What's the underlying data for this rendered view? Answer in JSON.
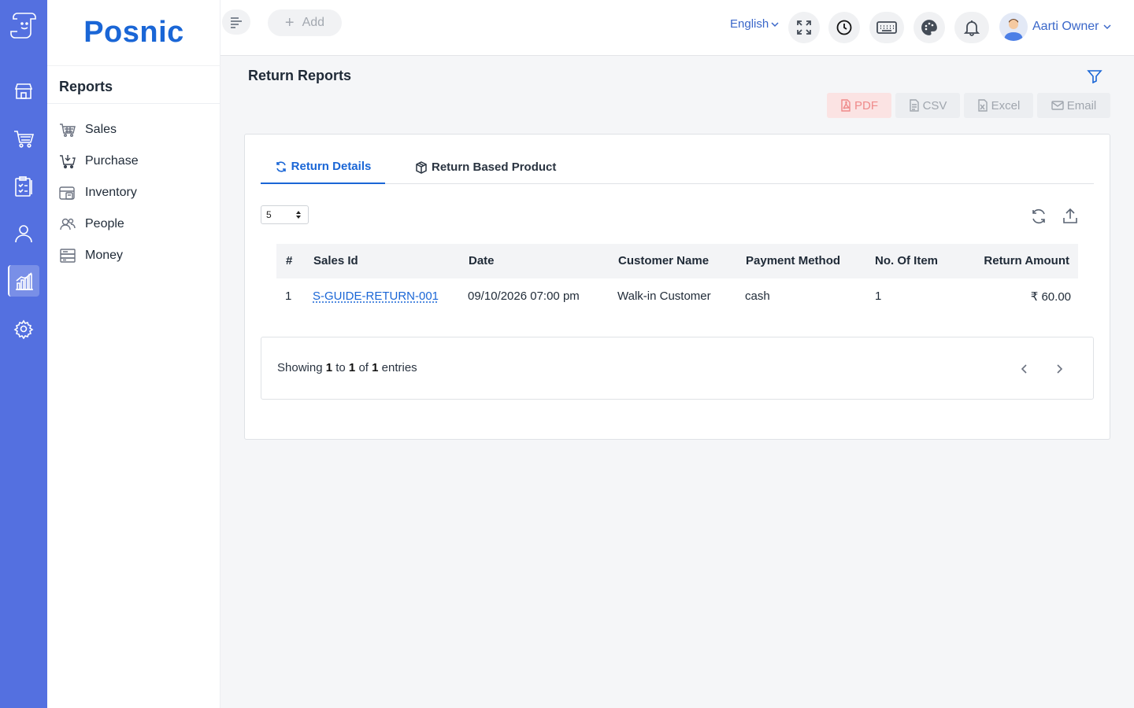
{
  "brand": {
    "name": "Posnic"
  },
  "rail": {
    "items": [
      {
        "icon": "store-icon"
      },
      {
        "icon": "cart-icon"
      },
      {
        "icon": "clipboard-icon"
      },
      {
        "icon": "user-icon"
      },
      {
        "icon": "chart-icon",
        "active": true
      },
      {
        "icon": "gear-icon"
      }
    ]
  },
  "sidebar": {
    "title": "Reports",
    "items": [
      {
        "label": "Sales",
        "icon": "basket-icon"
      },
      {
        "label": "Purchase",
        "icon": "cart-down-icon"
      },
      {
        "label": "Inventory",
        "icon": "inventory-icon"
      },
      {
        "label": "People",
        "icon": "people-icon"
      },
      {
        "label": "Money",
        "icon": "money-icon"
      }
    ]
  },
  "header": {
    "add_label": "Add",
    "language": "English",
    "user_name": "Aarti Owner"
  },
  "page": {
    "title": "Return Reports",
    "exports": {
      "pdf": "PDF",
      "csv": "CSV",
      "excel": "Excel",
      "email": "Email"
    }
  },
  "tabs": [
    {
      "label": "Return Details",
      "active": true
    },
    {
      "label": "Return Based Product",
      "active": false
    }
  ],
  "table": {
    "page_size": "5",
    "columns": [
      "#",
      "Sales Id",
      "Date",
      "Customer Name",
      "Payment Method",
      "No. Of Item",
      "Return Amount"
    ],
    "rows": [
      {
        "index": "1",
        "sales_id": "S-GUIDE-RETURN-001",
        "date": "09/10/2026 07:00 pm",
        "customer": "Walk-in Customer",
        "payment": "cash",
        "items": "1",
        "amount": "₹ 60.00"
      }
    ]
  },
  "pager": {
    "showing": "Showing",
    "from": "1",
    "to_word": "to",
    "to": "1",
    "of_word": "of",
    "total": "1",
    "entries": "entries"
  },
  "colors": {
    "rail": "#5470e0",
    "accent": "#1a66d6"
  }
}
